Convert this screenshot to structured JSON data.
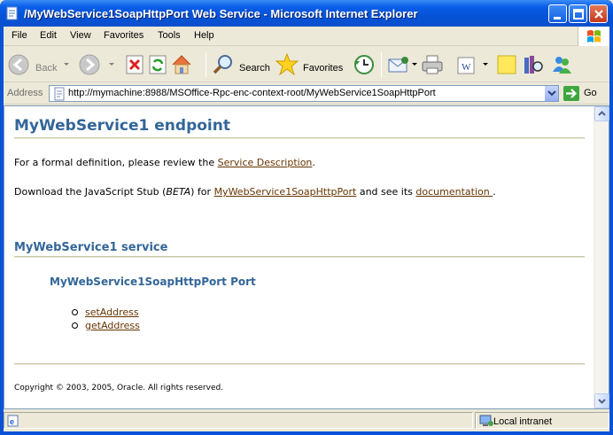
{
  "window": {
    "title": "/MyWebService1SoapHttpPort Web Service - Microsoft Internet Explorer"
  },
  "menu": {
    "items": [
      "File",
      "Edit",
      "View",
      "Favorites",
      "Tools",
      "Help"
    ]
  },
  "toolbar": {
    "back_label": "Back",
    "search_label": "Search",
    "favorites_label": "Favorites"
  },
  "address": {
    "label": "Address",
    "url": "http://mymachine:8988/MSOffice-Rpc-enc-context-root/MyWebService1SoapHttpPort",
    "go_label": "Go"
  },
  "page": {
    "heading": "MyWebService1 endpoint",
    "definition_prefix": "For a formal definition, please review the ",
    "definition_link": "Service Description",
    "definition_suffix": ".",
    "download_prefix": "Download the JavaScript Stub (",
    "download_beta": "BETA",
    "download_mid": ") for ",
    "download_link": "MyWebService1SoapHttpPort",
    "download_mid2": " and see its ",
    "download_doc_link": "documentation ",
    "download_suffix": ".",
    "service_heading": "MyWebService1 service",
    "port_heading": "MyWebService1SoapHttpPort Port",
    "operations": [
      "setAddress",
      "getAddress"
    ],
    "copyright": "Copyright © 2003, 2005, Oracle. All rights reserved."
  },
  "status": {
    "zone": "Local intranet"
  },
  "colors": {
    "heading": "#336699",
    "link": "#663300",
    "rule": "#C8C8A8",
    "titlebar": "#0A53D8"
  }
}
